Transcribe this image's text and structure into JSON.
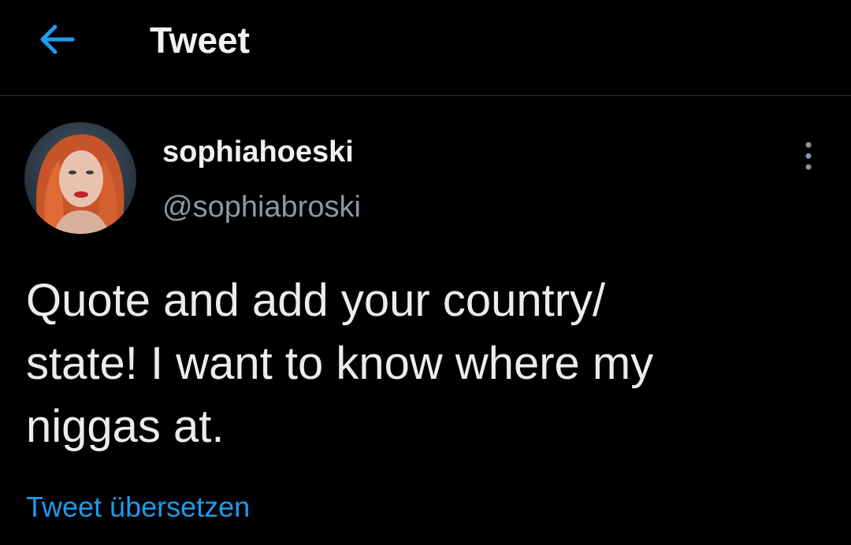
{
  "header": {
    "title": "Tweet"
  },
  "tweet": {
    "display_name": "sophiahoeski",
    "handle": "@sophiabroski",
    "text": "Quote and add your country/\nstate! I want to know where my\nniggas at.",
    "translate_label": "Tweet übersetzen"
  },
  "colors": {
    "background": "#000000",
    "accent": "#1d9bf0",
    "primary_text": "#e7e9ea",
    "secondary_text": "#8b98a5",
    "divider": "#2f3336"
  },
  "icons": {
    "back": "arrow-left-icon",
    "more": "more-vertical-icon"
  }
}
